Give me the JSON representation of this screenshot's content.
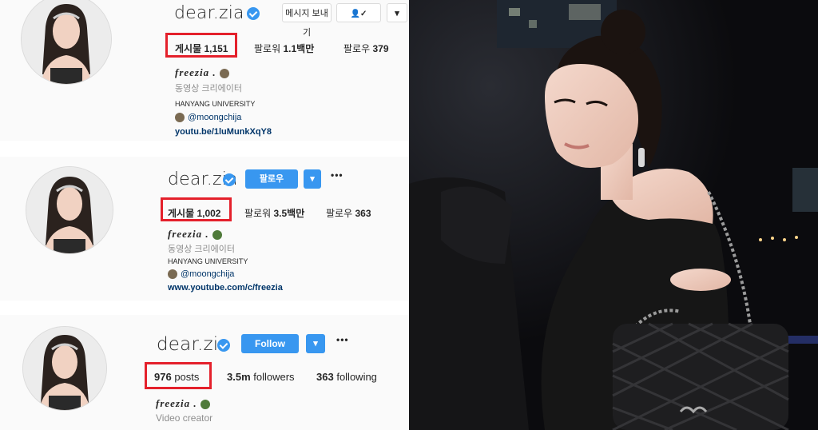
{
  "profiles": [
    {
      "username": "dear.zia",
      "button1": "메시지 보내기",
      "button2": "▾",
      "posts": "게시물 1,151",
      "followers_label": "팔로워",
      "followers_value": "1.1백만",
      "following_label": "팔로우",
      "following_value": "379",
      "bio_name": "freezia .",
      "bio_role": "동영상 크리에이터",
      "bio_school": "HANYANG UNIVERSITY",
      "bio_tag": "@moongchija",
      "bio_link": "youtu.be/1luMunkXqY8"
    },
    {
      "username": "dear.zia",
      "button1": "팔로우",
      "button2": "▾",
      "dots": "•••",
      "posts": "게시물 1,002",
      "followers_label": "팔로워",
      "followers_value": "3.5백만",
      "following_label": "팔로우",
      "following_value": "363",
      "bio_name": "freezia .",
      "bio_role": "동영상 크리에이터",
      "bio_school": "HANYANG UNIVERSITY",
      "bio_tag": "@moongchija",
      "bio_link": "www.youtube.com/c/freezia"
    },
    {
      "username": "dear.zia",
      "button1": "Follow",
      "button2": "▾",
      "dots": "•••",
      "posts_value": "976",
      "posts_label": "posts",
      "followers_value": "3.5m",
      "followers_label": "followers",
      "following_value": "363",
      "following_label": "following",
      "bio_name": "freezia .",
      "bio_role": "Video creator"
    }
  ],
  "colors": {
    "highlight": "#e4202b",
    "ig_blue": "#3897f0",
    "link": "#003569"
  }
}
